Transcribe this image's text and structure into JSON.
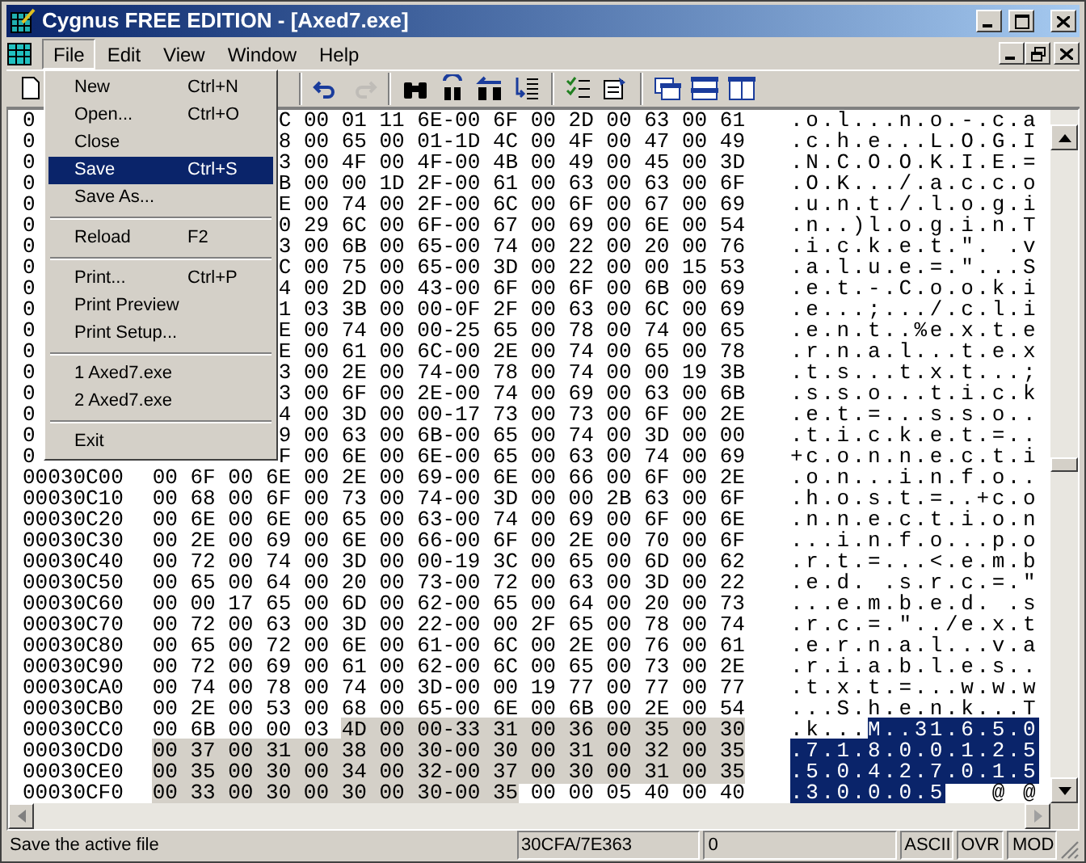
{
  "window": {
    "title": "Cygnus FREE EDITION - [Axed7.exe]"
  },
  "menubar": [
    {
      "label": "File",
      "selected": true
    },
    {
      "label": "Edit",
      "selected": false
    },
    {
      "label": "View",
      "selected": false
    },
    {
      "label": "Window",
      "selected": false
    },
    {
      "label": "Help",
      "selected": false
    }
  ],
  "file_menu": [
    {
      "kind": "item",
      "label": "New",
      "shortcut": "Ctrl+N",
      "selected": false
    },
    {
      "kind": "item",
      "label": "Open...",
      "shortcut": "Ctrl+O",
      "selected": false
    },
    {
      "kind": "item",
      "label": "Close",
      "selected": false
    },
    {
      "kind": "item",
      "label": "Save",
      "shortcut": "Ctrl+S",
      "selected": true
    },
    {
      "kind": "item",
      "label": "Save As...",
      "selected": false
    },
    {
      "kind": "separator"
    },
    {
      "kind": "item",
      "label": "Reload",
      "shortcut": "F2",
      "selected": false
    },
    {
      "kind": "separator"
    },
    {
      "kind": "item",
      "label": "Print...",
      "shortcut": "Ctrl+P",
      "selected": false
    },
    {
      "kind": "item",
      "label": "Print Preview",
      "selected": false
    },
    {
      "kind": "item",
      "label": "Print Setup...",
      "selected": false
    },
    {
      "kind": "separator"
    },
    {
      "kind": "item",
      "label": "1 Axed7.exe",
      "selected": false
    },
    {
      "kind": "item",
      "label": "2 Axed7.exe",
      "selected": false
    },
    {
      "kind": "separator"
    },
    {
      "kind": "item",
      "label": "Exit",
      "selected": false
    }
  ],
  "toolbar": [
    {
      "kind": "new",
      "disabled": false
    },
    {
      "kind": "separator"
    },
    {
      "kind": "undo",
      "disabled": false
    },
    {
      "kind": "redo",
      "disabled": true
    },
    {
      "kind": "separator"
    },
    {
      "kind": "find",
      "disabled": false
    },
    {
      "kind": "replace",
      "disabled": false
    },
    {
      "kind": "find-previous",
      "disabled": false
    },
    {
      "kind": "goto",
      "disabled": false
    },
    {
      "kind": "separator"
    },
    {
      "kind": "checklist",
      "disabled": false
    },
    {
      "kind": "properties",
      "disabled": false
    },
    {
      "kind": "separator"
    },
    {
      "kind": "cascade",
      "disabled": false
    },
    {
      "kind": "tile-horizontal",
      "disabled": false
    },
    {
      "kind": "tile-vertical",
      "disabled": false
    }
  ],
  "rows": [
    {
      "address": "0",
      "hex": [
        {
          "text": "C 00 01 11 6E-00 6F 00 2D 00 63 00 61",
          "selected": false
        }
      ],
      "ascii": [
        {
          "text": ".o.l...n.o.-.c.a",
          "selected": false
        }
      ]
    },
    {
      "address": "0",
      "hex": [
        {
          "text": "8 00 65 00 01-1D 4C 00 4F 00 47 00 49",
          "selected": false
        }
      ],
      "ascii": [
        {
          "text": ".c.h.e...L.O.G.I",
          "selected": false
        }
      ]
    },
    {
      "address": "0",
      "hex": [
        {
          "text": "3 00 4F 00 4F-00 4B 00 49 00 45 00 3D",
          "selected": false
        }
      ],
      "ascii": [
        {
          "text": ".N.C.O.O.K.I.E.=",
          "selected": false
        }
      ]
    },
    {
      "address": "0",
      "hex": [
        {
          "text": "B 00 00 1D 2F-00 61 00 63 00 63 00 6F",
          "selected": false
        }
      ],
      "ascii": [
        {
          "text": ".O.K.../.a.c.c.o",
          "selected": false
        }
      ]
    },
    {
      "address": "0",
      "hex": [
        {
          "text": "E 00 74 00 2F-00 6C 00 6F 00 67 00 69",
          "selected": false
        }
      ],
      "ascii": [
        {
          "text": ".u.n.t./.l.o.g.i",
          "selected": false
        }
      ]
    },
    {
      "address": "0",
      "hex": [
        {
          "text": "0 29 6C 00 6F-00 67 00 69 00 6E 00 54",
          "selected": false
        }
      ],
      "ascii": [
        {
          "text": ".n..)l.o.g.i.n.T",
          "selected": false
        }
      ]
    },
    {
      "address": "0",
      "hex": [
        {
          "text": "3 00 6B 00 65-00 74 00 22 00 20 00 76",
          "selected": false
        }
      ],
      "ascii": [
        {
          "text": ".i.c.k.e.t.\". .v",
          "selected": false
        }
      ]
    },
    {
      "address": "0",
      "hex": [
        {
          "text": "C 00 75 00 65-00 3D 00 22 00 00 15 53",
          "selected": false
        }
      ],
      "ascii": [
        {
          "text": ".a.l.u.e.=.\"...S",
          "selected": false
        }
      ]
    },
    {
      "address": "0",
      "hex": [
        {
          "text": "4 00 2D 00 43-00 6F 00 6F 00 6B 00 69",
          "selected": false
        }
      ],
      "ascii": [
        {
          "text": ".e.t.-.C.o.o.k.i",
          "selected": false
        }
      ]
    },
    {
      "address": "0",
      "hex": [
        {
          "text": "1 03 3B 00 00-0F 2F 00 63 00 6C 00 69",
          "selected": false
        }
      ],
      "ascii": [
        {
          "text": ".e...;.../.c.l.i",
          "selected": false
        }
      ]
    },
    {
      "address": "0",
      "hex": [
        {
          "text": "E 00 74 00 00-25 65 00 78 00 74 00 65",
          "selected": false
        }
      ],
      "ascii": [
        {
          "text": ".e.n.t..%e.x.t.e",
          "selected": false
        }
      ]
    },
    {
      "address": "0",
      "hex": [
        {
          "text": "E 00 61 00 6C-00 2E 00 74 00 65 00 78",
          "selected": false
        }
      ],
      "ascii": [
        {
          "text": ".r.n.a.l...t.e.x",
          "selected": false
        }
      ]
    },
    {
      "address": "0",
      "hex": [
        {
          "text": "3 00 2E 00 74-00 78 00 74 00 00 19 3B",
          "selected": false
        }
      ],
      "ascii": [
        {
          "text": ".t.s...t.x.t...;",
          "selected": false
        }
      ]
    },
    {
      "address": "0",
      "hex": [
        {
          "text": "3 00 6F 00 2E-00 74 00 69 00 63 00 6B",
          "selected": false
        }
      ],
      "ascii": [
        {
          "text": ".s.s.o...t.i.c.k",
          "selected": false
        }
      ]
    },
    {
      "address": "0",
      "hex": [
        {
          "text": "4 00 3D 00 00-17 73 00 73 00 6F 00 2E",
          "selected": false
        }
      ],
      "ascii": [
        {
          "text": ".e.t.=...s.s.o..",
          "selected": false
        }
      ]
    },
    {
      "address": "0",
      "hex": [
        {
          "text": "9 00 63 00 6B-00 65 00 74 00 3D 00 00",
          "selected": false
        }
      ],
      "ascii": [
        {
          "text": ".t.i.c.k.e.t.=..",
          "selected": false
        }
      ]
    },
    {
      "address": "0",
      "hex": [
        {
          "text": "F 00 6E 00 6E-00 65 00 63 00 74 00 69",
          "selected": false
        }
      ],
      "ascii": [
        {
          "text": "+c.o.n.n.e.c.t.i",
          "selected": false
        }
      ]
    },
    {
      "address": "00030C00",
      "hex": [
        {
          "text": "00 6F 00 6E 00 2E 00 69-00 6E 00 66 00 6F 00 2E",
          "selected": false
        }
      ],
      "ascii": [
        {
          "text": ".o.n...i.n.f.o..",
          "selected": false
        }
      ]
    },
    {
      "address": "00030C10",
      "hex": [
        {
          "text": "00 68 00 6F 00 73 00 74-00 3D 00 00 2B 63 00 6F",
          "selected": false
        }
      ],
      "ascii": [
        {
          "text": ".h.o.s.t.=..+c.o",
          "selected": false
        }
      ]
    },
    {
      "address": "00030C20",
      "hex": [
        {
          "text": "00 6E 00 6E 00 65 00 63-00 74 00 69 00 6F 00 6E",
          "selected": false
        }
      ],
      "ascii": [
        {
          "text": ".n.n.e.c.t.i.o.n",
          "selected": false
        }
      ]
    },
    {
      "address": "00030C30",
      "hex": [
        {
          "text": "00 2E 00 69 00 6E 00 66-00 6F 00 2E 00 70 00 6F",
          "selected": false
        }
      ],
      "ascii": [
        {
          "text": "...i.n.f.o...p.o",
          "selected": false
        }
      ]
    },
    {
      "address": "00030C40",
      "hex": [
        {
          "text": "00 72 00 74 00 3D 00 00-19 3C 00 65 00 6D 00 62",
          "selected": false
        }
      ],
      "ascii": [
        {
          "text": ".r.t.=...<.e.m.b",
          "selected": false
        }
      ]
    },
    {
      "address": "00030C50",
      "hex": [
        {
          "text": "00 65 00 64 00 20 00 73-00 72 00 63 00 3D 00 22",
          "selected": false
        }
      ],
      "ascii": [
        {
          "text": ".e.d. .s.r.c.=.\"",
          "selected": false
        }
      ]
    },
    {
      "address": "00030C60",
      "hex": [
        {
          "text": "00 00 17 65 00 6D 00 62-00 65 00 64 00 20 00 73",
          "selected": false
        }
      ],
      "ascii": [
        {
          "text": "...e.m.b.e.d. .s",
          "selected": false
        }
      ]
    },
    {
      "address": "00030C70",
      "hex": [
        {
          "text": "00 72 00 63 00 3D 00 22-00 00 2F 65 00 78 00 74",
          "selected": false
        }
      ],
      "ascii": [
        {
          "text": ".r.c.=.\"../e.x.t",
          "selected": false
        }
      ]
    },
    {
      "address": "00030C80",
      "hex": [
        {
          "text": "00 65 00 72 00 6E 00 61-00 6C 00 2E 00 76 00 61",
          "selected": false
        }
      ],
      "ascii": [
        {
          "text": ".e.r.n.a.l...v.a",
          "selected": false
        }
      ]
    },
    {
      "address": "00030C90",
      "hex": [
        {
          "text": "00 72 00 69 00 61 00 62-00 6C 00 65 00 73 00 2E",
          "selected": false
        }
      ],
      "ascii": [
        {
          "text": ".r.i.a.b.l.e.s..",
          "selected": false
        }
      ]
    },
    {
      "address": "00030CA0",
      "hex": [
        {
          "text": "00 74 00 78 00 74 00 3D-00 00 19 77 00 77 00 77",
          "selected": false
        }
      ],
      "ascii": [
        {
          "text": ".t.x.t.=...w.w.w",
          "selected": false
        }
      ]
    },
    {
      "address": "00030CB0",
      "hex": [
        {
          "text": "00 2E 00 53 00 68 00 65-00 6E 00 6B 00 2E 00 54",
          "selected": false
        }
      ],
      "ascii": [
        {
          "text": "...S.h.e.n.k...T",
          "selected": false
        }
      ]
    },
    {
      "address": "00030CC0",
      "hex": [
        {
          "text": "00 6B 00 00 03 ",
          "selected": false
        },
        {
          "text": "4D 00 00-33 31 00 36 00 35 00 30",
          "selected": true
        }
      ],
      "ascii": [
        {
          "text": ".k...",
          "selected": false
        },
        {
          "text": "M..31.6.5.0",
          "selected": true
        }
      ]
    },
    {
      "address": "00030CD0",
      "hex": [
        {
          "text": "00 37 00 31 00 38 00 30-00 30 00 31 00 32 00 35",
          "selected": true
        }
      ],
      "ascii": [
        {
          "text": ".7.1.8.0.0.1.2.5",
          "selected": true
        }
      ]
    },
    {
      "address": "00030CE0",
      "hex": [
        {
          "text": "00 35 00 30 00 34 00 32-00 37 00 30 00 31 00 35",
          "selected": true
        }
      ],
      "ascii": [
        {
          "text": ".5.0.4.2.7.0.1.5",
          "selected": true
        }
      ]
    },
    {
      "address": "00030CF0",
      "hex": [
        {
          "text": "00 33 00 30 00 30 00 30-00 35",
          "selected": true
        },
        {
          "text": " 00 00 05 40 00 40",
          "selected": false
        }
      ],
      "ascii": [
        {
          "text": ".3.0.0.0.5",
          "selected": true
        },
        {
          "text": "   @ @",
          "selected": false
        }
      ]
    }
  ],
  "status_bar": {
    "message": "Save the active file",
    "position": "30CFA/7E363",
    "value": "0",
    "mode": "ASCII",
    "overwrite": "OVR",
    "modified": "MOD"
  }
}
